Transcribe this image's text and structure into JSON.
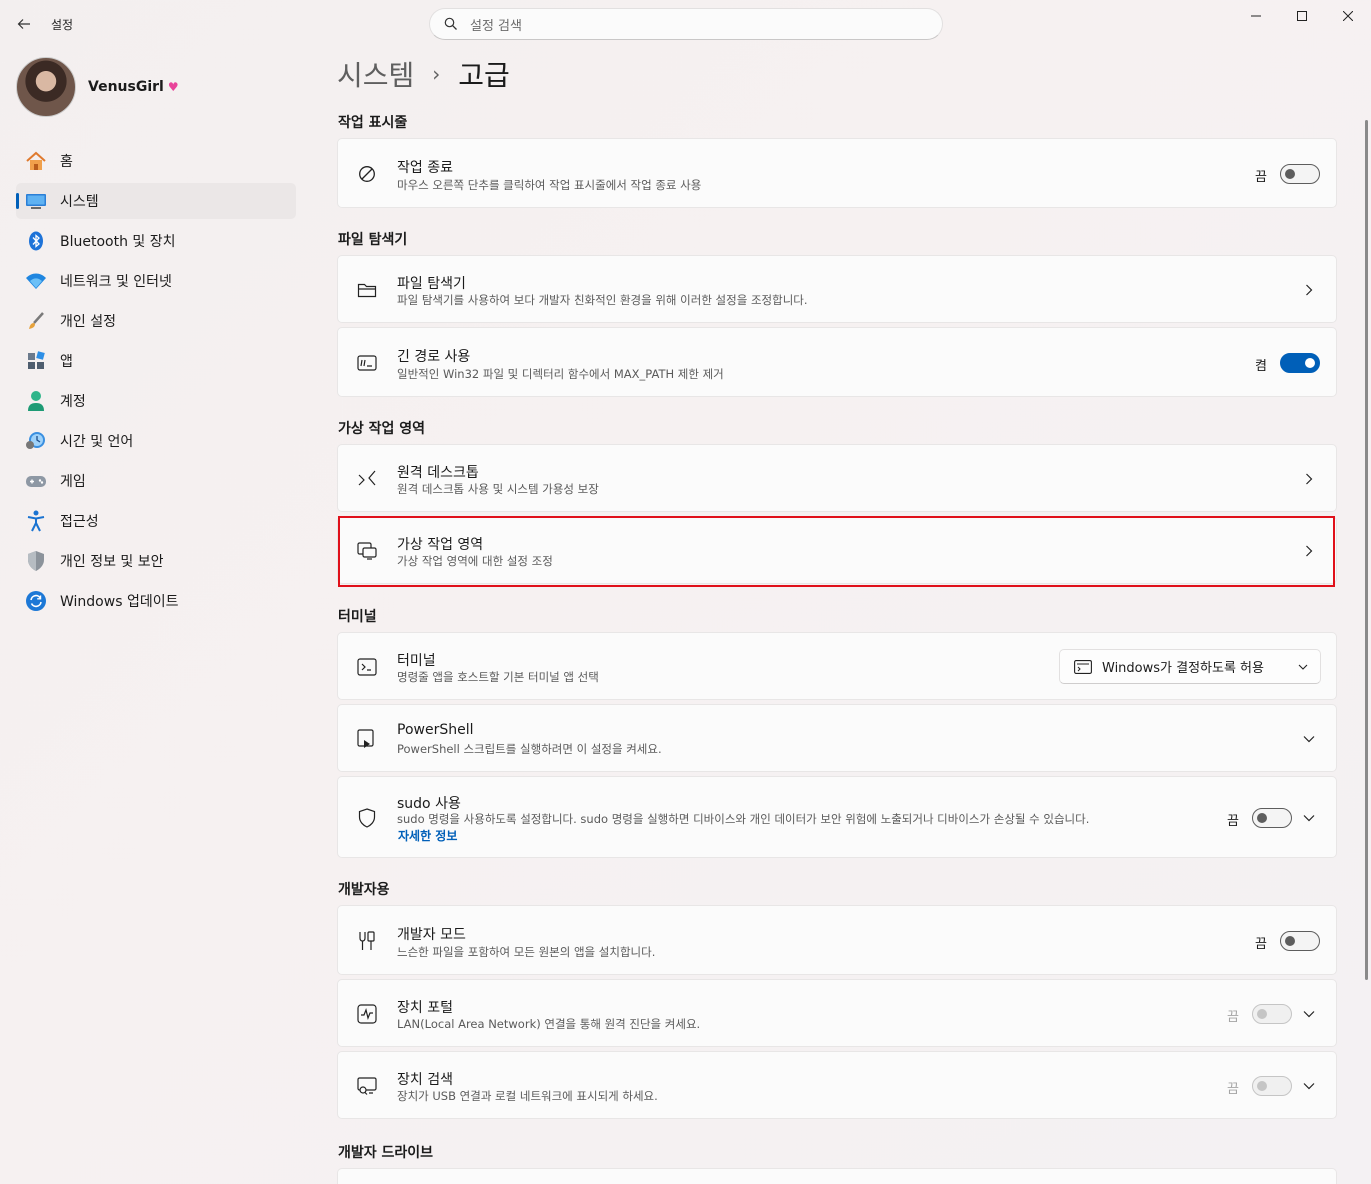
{
  "window": {
    "title": "설정",
    "search_placeholder": "설정 검색"
  },
  "profile": {
    "name": "VenusGirl"
  },
  "nav": [
    {
      "label": "홈",
      "icon": "home-icon"
    },
    {
      "label": "시스템",
      "icon": "system-icon",
      "active": true
    },
    {
      "label": "Bluetooth 및 장치",
      "icon": "bluetooth-icon"
    },
    {
      "label": "네트워크 및 인터넷",
      "icon": "wifi-icon"
    },
    {
      "label": "개인 설정",
      "icon": "brush-icon"
    },
    {
      "label": "앱",
      "icon": "apps-icon"
    },
    {
      "label": "계정",
      "icon": "account-icon"
    },
    {
      "label": "시간 및 언어",
      "icon": "time-language-icon"
    },
    {
      "label": "게임",
      "icon": "gamepad-icon"
    },
    {
      "label": "접근성",
      "icon": "accessibility-icon"
    },
    {
      "label": "개인 정보 및 보안",
      "icon": "shield-icon"
    },
    {
      "label": "Windows 업데이트",
      "icon": "update-icon"
    }
  ],
  "breadcrumb": {
    "parent": "시스템",
    "separator": "›",
    "current": "고급"
  },
  "sections": {
    "taskbar": "작업 표시줄",
    "file_explorer": "파일 탐색기",
    "virtual_workspaces": "가상 작업 영역",
    "terminal": "터미널",
    "developer": "개발자용",
    "dev_drive": "개발자 드라이브"
  },
  "settings": {
    "end_task": {
      "title": "작업 종료",
      "desc": "마우스 오른쪽 단추를 클릭하여 작업 표시줄에서 작업 종료 사용",
      "state": "끔",
      "on": false
    },
    "file_explorer": {
      "title": "파일 탐색기",
      "desc": "파일 탐색기를 사용하여 보다 개발자 친화적인 환경을 위해 이러한 설정을 조정합니다."
    },
    "long_paths": {
      "title": "긴 경로 사용",
      "desc": "일반적인 Win32 파일 및 디렉터리 함수에서 MAX_PATH 제한 제거",
      "state": "켬",
      "on": true
    },
    "remote_desktop": {
      "title": "원격 데스크톱",
      "desc": "원격 데스크톱 사용 및 시스템 가용성 보장"
    },
    "virtual_workspaces": {
      "title": "가상 작업 영역",
      "desc": "가상 작업 영역에 대한 설정 조정"
    },
    "terminal": {
      "title": "터미널",
      "desc": "명령줄 앱을 호스트할 기본 터미널 앱 선택",
      "dropdown_value": "Windows가 결정하도록 허용"
    },
    "powershell": {
      "title": "PowerShell",
      "desc": "PowerShell 스크립트를 실행하려면 이 설정을 켜세요."
    },
    "sudo": {
      "title": "sudo 사용",
      "desc": "sudo 명령을 사용하도록 설정합니다. sudo 명령을 실행하면 디바이스와 개인 데이터가 보안 위험에 노출되거나 디바이스가 손상될 수 있습니다.",
      "link": "자세한 정보",
      "state": "끔",
      "on": false
    },
    "developer_mode": {
      "title": "개발자 모드",
      "desc": "느슨한 파일을 포함하여 모든 원본의 앱을 설치합니다.",
      "state": "끔",
      "on": false
    },
    "device_portal": {
      "title": "장치 포털",
      "desc": "LAN(Local Area Network) 연결을 통해 원격 진단을 켜세요.",
      "state": "끔",
      "on": false,
      "disabled": true
    },
    "device_discovery": {
      "title": "장치 검색",
      "desc": "장치가 USB 연결과 로컬 네트워크에 표시되게 하세요.",
      "state": "끔",
      "on": false,
      "disabled": true
    }
  },
  "colors": {
    "accent": "#005fb8",
    "highlight_border": "#e0101a"
  }
}
